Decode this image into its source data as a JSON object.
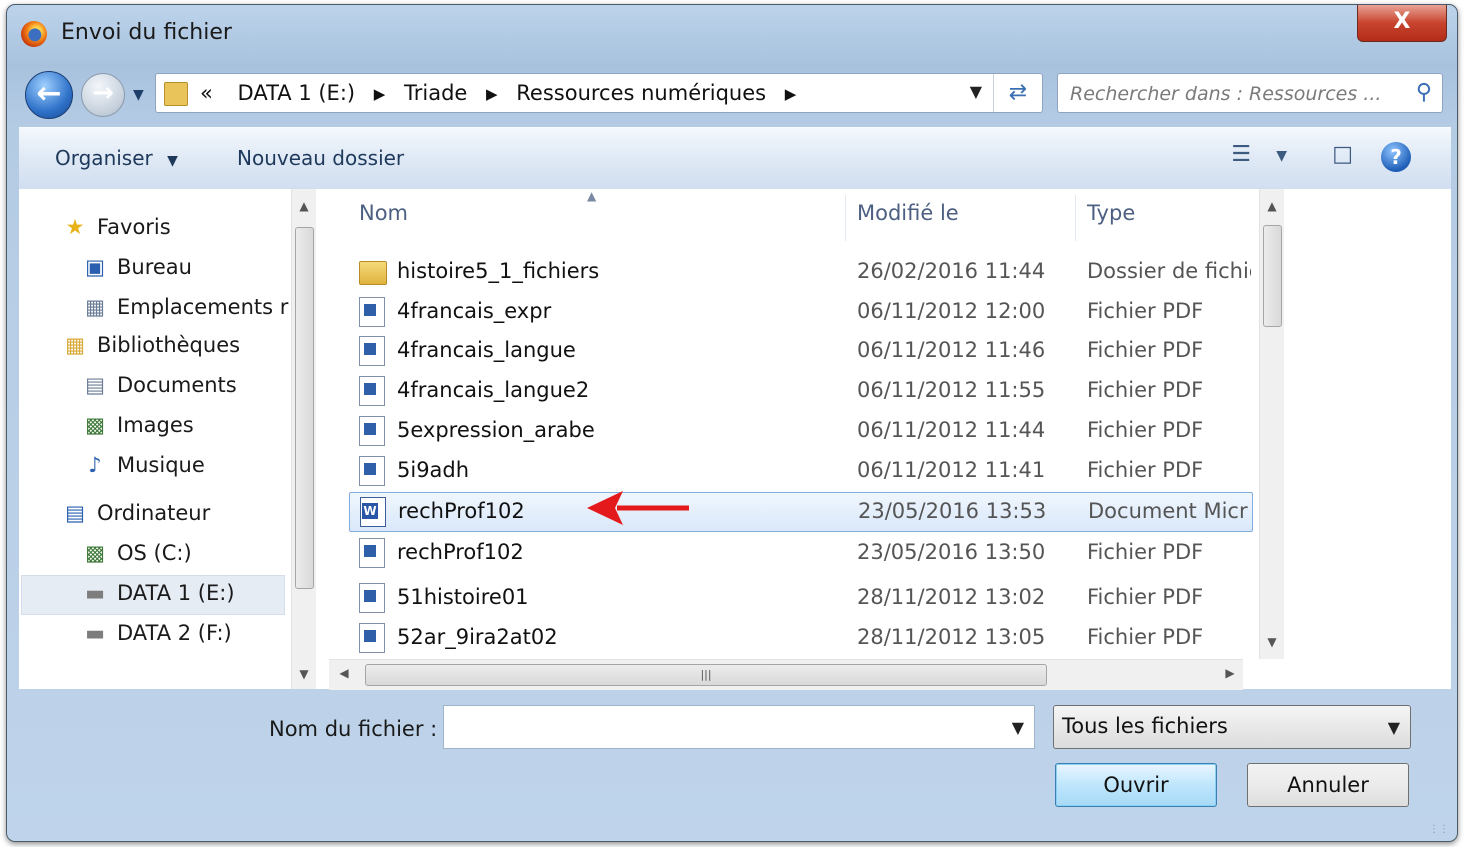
{
  "window": {
    "title": "Envoi du fichier",
    "close_label": "X"
  },
  "nav": {
    "breadcrumbs": [
      "«",
      "DATA 1 (E:)",
      "Triade",
      "Ressources numériques"
    ],
    "search_placeholder": "Rechercher dans : Ressources ..."
  },
  "toolbar": {
    "organize": "Organiser",
    "new_folder": "Nouveau dossier"
  },
  "sidebar": {
    "items": [
      {
        "label": "Favoris",
        "icon": "star-icon"
      },
      {
        "label": "Bureau",
        "icon": "desktop-icon"
      },
      {
        "label": "Emplacements r",
        "icon": "recent-places-icon"
      },
      {
        "label": "Bibliothèques",
        "icon": "libraries-icon"
      },
      {
        "label": "Documents",
        "icon": "documents-icon"
      },
      {
        "label": "Images",
        "icon": "pictures-icon"
      },
      {
        "label": "Musique",
        "icon": "music-icon"
      },
      {
        "label": "Ordinateur",
        "icon": "computer-icon"
      },
      {
        "label": "OS (C:)",
        "icon": "system-drive-icon"
      },
      {
        "label": "DATA 1 (E:)",
        "icon": "drive-icon",
        "selected": true
      },
      {
        "label": "DATA 2 (F:)",
        "icon": "drive-icon"
      }
    ]
  },
  "file_list": {
    "columns": [
      "Nom",
      "Modifié le",
      "Type"
    ],
    "rows": [
      {
        "name": "histoire5_1_fichiers",
        "date": "26/02/2016 11:44",
        "type": "Dossier de fichie",
        "icon": "folder-icon"
      },
      {
        "name": "4francais_expr",
        "date": "06/11/2012 12:00",
        "type": "Fichier PDF",
        "icon": "pdf-icon"
      },
      {
        "name": "4francais_langue",
        "date": "06/11/2012 11:46",
        "type": "Fichier PDF",
        "icon": "pdf-icon"
      },
      {
        "name": "4francais_langue2",
        "date": "06/11/2012 11:55",
        "type": "Fichier PDF",
        "icon": "pdf-icon"
      },
      {
        "name": "5expression_arabe",
        "date": "06/11/2012 11:44",
        "type": "Fichier PDF",
        "icon": "pdf-icon"
      },
      {
        "name": "5i9adh",
        "date": "06/11/2012 11:41",
        "type": "Fichier PDF",
        "icon": "pdf-icon"
      },
      {
        "name": "rechProf102",
        "date": "23/05/2016 13:53",
        "type": "Document Micr",
        "icon": "word-icon",
        "selected": true
      },
      {
        "name": "rechProf102",
        "date": "23/05/2016 13:50",
        "type": "Fichier PDF",
        "icon": "pdf-icon"
      },
      {
        "name": "51histoire01",
        "date": "28/11/2012 13:02",
        "type": "Fichier PDF",
        "icon": "pdf-icon"
      },
      {
        "name": "52ar_9ira2at02",
        "date": "28/11/2012 13:05",
        "type": "Fichier PDF",
        "icon": "pdf-icon"
      }
    ]
  },
  "footer": {
    "filename_label": "Nom du fichier :",
    "filename_value": "",
    "filetype_value": "Tous les fichiers",
    "open_label": "Ouvrir",
    "cancel_label": "Annuler"
  },
  "colors": {
    "annotation_arrow": "#e3191c",
    "selection": "#d9e8fa"
  }
}
